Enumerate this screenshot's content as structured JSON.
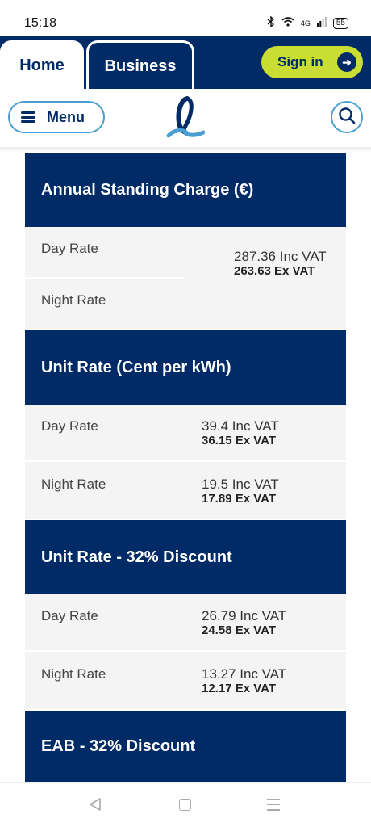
{
  "status_bar": {
    "time": "15:18",
    "icons": [
      "bluetooth-icon",
      "wifi-icon",
      "signal-icon"
    ],
    "network": "4G",
    "battery": "55"
  },
  "nav": {
    "tab_home": "Home",
    "tab_business": "Business",
    "sign_in": "Sign in"
  },
  "header": {
    "menu_label": "Menu"
  },
  "colors": {
    "brand_navy": "#012b66",
    "accent_lime": "#c9dd32",
    "outline_blue": "#4a9fd0"
  },
  "sections": {
    "standing": {
      "title": "Annual Standing Charge (€)",
      "day_label": "Day Rate",
      "night_label": "Night Rate",
      "inc": "287.36 Inc VAT",
      "ex": "263.63 Ex VAT"
    },
    "unit": {
      "title": "Unit Rate (Cent per kWh)",
      "day_label": "Day Rate",
      "day_inc": "39.4 Inc VAT",
      "day_ex": "36.15 Ex VAT",
      "night_label": "Night Rate",
      "night_inc": "19.5 Inc VAT",
      "night_ex": "17.89 Ex VAT"
    },
    "discount": {
      "title": "Unit Rate - 32% Discount",
      "day_label": "Day Rate",
      "day_inc": "26.79 Inc VAT",
      "day_ex": "24.58 Ex VAT",
      "night_label": "Night Rate",
      "night_inc": "13.27 Inc VAT",
      "night_ex": "12.17 Ex VAT"
    },
    "eab": {
      "title": "EAB - 32% Discount"
    }
  }
}
